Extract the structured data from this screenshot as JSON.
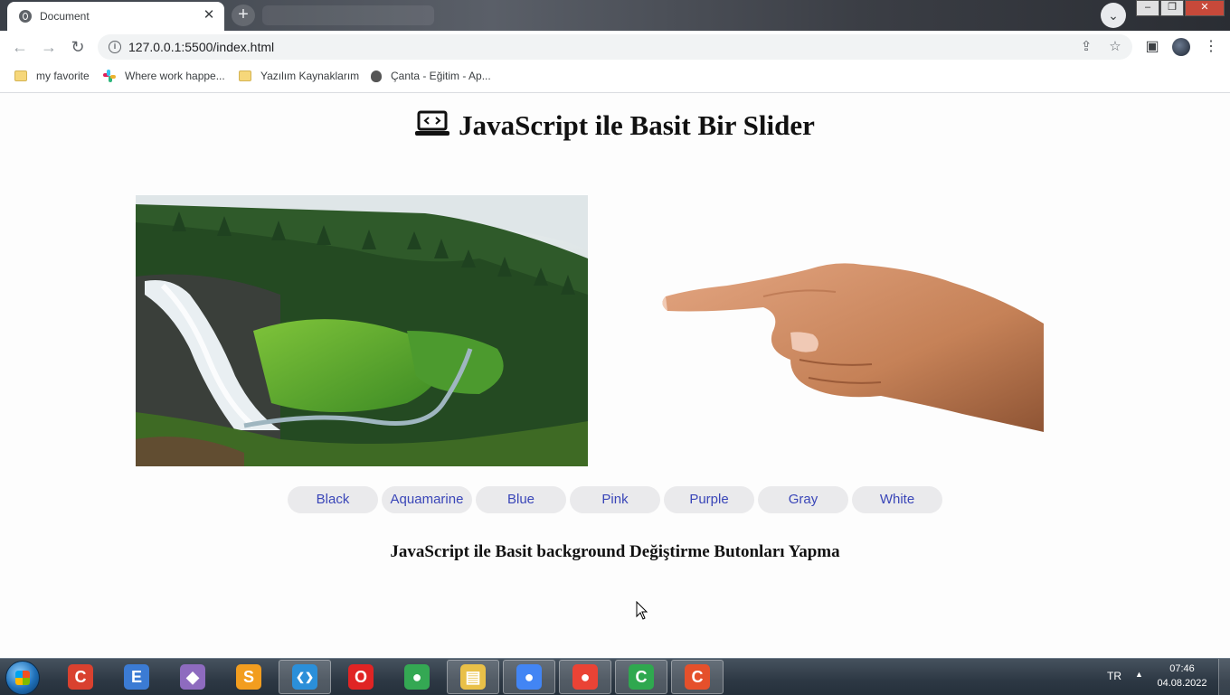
{
  "browser": {
    "tab_title": "Document",
    "tab_close": "✕",
    "new_tab": "+",
    "url": "127.0.0.1:5500/index.html"
  },
  "bookmarks": [
    {
      "label": "my favorite",
      "icon": "folder-icon"
    },
    {
      "label": "Where work happe...",
      "icon": "slack-icon"
    },
    {
      "label": "Yazılım Kaynaklarım",
      "icon": "folder-icon"
    },
    {
      "label": "Çanta - Eğitim - Ap...",
      "icon": "apple-icon"
    }
  ],
  "page": {
    "heading": "JavaScript ile Basit Bir Slider",
    "subtitle": "JavaScript ile Basit background Değiştirme Butonları Yapma",
    "color_buttons": [
      "Black",
      "Aquamarine",
      "Blue",
      "Pink",
      "Purple",
      "Gray",
      "White"
    ]
  },
  "taskbar": {
    "apps": [
      {
        "name": "ccleaner-icon",
        "glyph": "C",
        "color": "#d9412f"
      },
      {
        "name": "editor-icon",
        "glyph": "E",
        "color": "#3b7bd4"
      },
      {
        "name": "git-icon",
        "glyph": "◆",
        "color": "#8e6bbf"
      },
      {
        "name": "sublime-text-icon",
        "glyph": "S",
        "color": "#f29d1f"
      },
      {
        "name": "vscode-icon",
        "glyph": "❮❯",
        "color": "#2b8fd9"
      },
      {
        "name": "opera-icon",
        "glyph": "O",
        "color": "#e02424"
      },
      {
        "name": "chrome-icon",
        "glyph": "●",
        "color": "#34a853"
      },
      {
        "name": "file-explorer-icon",
        "glyph": "▤",
        "color": "#e9c048"
      },
      {
        "name": "chrome-profile-icon",
        "glyph": "●",
        "color": "#4285f4"
      },
      {
        "name": "chrome-profile2-icon",
        "glyph": "●",
        "color": "#ea4335"
      },
      {
        "name": "camtasia-icon",
        "glyph": "C",
        "color": "#2fa84f"
      },
      {
        "name": "camtasia-recorder-icon",
        "glyph": "C",
        "color": "#e5502b"
      }
    ],
    "language": "TR",
    "tray_arrow": "▲",
    "time": "07:46",
    "date": "04.08.2022"
  }
}
